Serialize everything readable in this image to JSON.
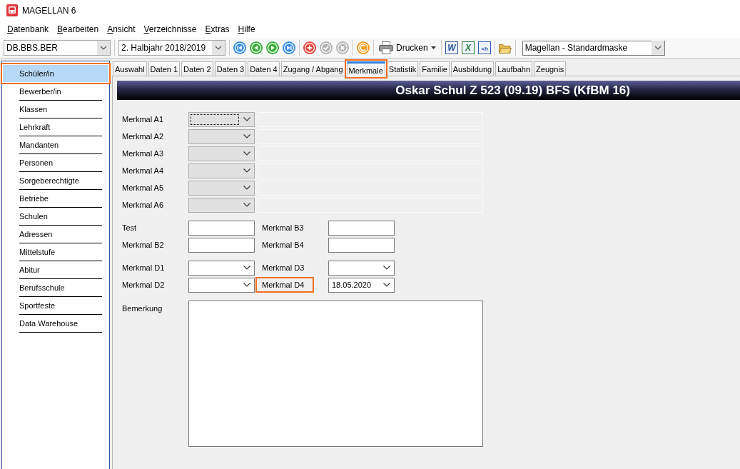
{
  "window": {
    "title": "MAGELLAN 6"
  },
  "menu": [
    {
      "label": "Datenbank"
    },
    {
      "label": "Bearbeiten"
    },
    {
      "label": "Ansicht"
    },
    {
      "label": "Verzeichnisse"
    },
    {
      "label": "Extras"
    },
    {
      "label": "Hilfe"
    }
  ],
  "toolbar": {
    "groups": [
      [
        {
          "kind": "combo",
          "value": "DB.BBS.BER"
        }
      ],
      [
        {
          "kind": "combo",
          "value": "2. Halbjahr 2018/2019"
        }
      ],
      [
        {
          "kind": "first",
          "disabled": false
        },
        {
          "kind": "previous",
          "disabled": false
        },
        {
          "kind": "next",
          "disabled": false
        },
        {
          "kind": "last",
          "disabled": false
        }
      ],
      [
        {
          "kind": "add",
          "disabled": false
        },
        {
          "kind": "save",
          "disabled": true
        },
        {
          "kind": "cancel",
          "disabled": true
        }
      ],
      [
        {
          "kind": "refresh",
          "disabled": false
        }
      ],
      [
        {
          "kind": "print",
          "label": "Drucken",
          "disabled": false
        }
      ],
      [
        {
          "kind": "word",
          "glyph": "W",
          "disabled": false
        },
        {
          "kind": "excel",
          "glyph": "X",
          "disabled": false
        },
        {
          "kind": "html",
          "glyph": "<h",
          "disabled": false
        }
      ],
      [
        {
          "kind": "folder",
          "disabled": false
        }
      ],
      [
        {
          "kind": "combo",
          "value": "Magellan - Standardmaske"
        }
      ]
    ]
  },
  "sidebar": {
    "items": [
      {
        "label": "Schüler/in",
        "selected": true,
        "highlighted": true
      },
      {
        "label": "Bewerber/in",
        "selected": false,
        "highlighted": false
      },
      {
        "label": "Klassen",
        "selected": false,
        "highlighted": false
      },
      {
        "label": "Lehrkraft",
        "selected": false,
        "highlighted": false
      },
      {
        "label": "Mandanten",
        "selected": false,
        "highlighted": false
      },
      {
        "label": "Personen",
        "selected": false,
        "highlighted": false
      },
      {
        "label": "Sorgeberechtigte",
        "selected": false,
        "highlighted": false
      },
      {
        "label": "Betriebe",
        "selected": false,
        "highlighted": false
      },
      {
        "label": "Schulen",
        "selected": false,
        "highlighted": false
      },
      {
        "label": "Adressen",
        "selected": false,
        "highlighted": false
      },
      {
        "label": "Mittelstufe",
        "selected": false,
        "highlighted": false
      },
      {
        "label": "Abitur",
        "selected": false,
        "highlighted": false
      },
      {
        "label": "Berufsschule",
        "selected": false,
        "highlighted": false
      },
      {
        "label": "Sportfeste",
        "selected": false,
        "highlighted": false
      },
      {
        "label": "Data Warehouse",
        "selected": false,
        "highlighted": false
      }
    ]
  },
  "tabs": [
    {
      "label": "Auswahl",
      "selected": false,
      "highlighted": false
    },
    {
      "label": "Daten 1",
      "selected": false,
      "highlighted": false
    },
    {
      "label": "Daten 2",
      "selected": false,
      "highlighted": false
    },
    {
      "label": "Daten 3",
      "selected": false,
      "highlighted": false
    },
    {
      "label": "Daten 4",
      "selected": false,
      "highlighted": false
    },
    {
      "label": "Zugang / Abgang",
      "selected": false,
      "highlighted": false
    },
    {
      "label": "Merkmale",
      "selected": true,
      "highlighted": true
    },
    {
      "label": "Statistik",
      "selected": false,
      "highlighted": false
    },
    {
      "label": "Familie",
      "selected": false,
      "highlighted": false
    },
    {
      "label": "Ausbildung",
      "selected": false,
      "highlighted": false
    },
    {
      "label": "Laufbahn",
      "selected": false,
      "highlighted": false
    },
    {
      "label": "Zeugnis",
      "selected": false,
      "highlighted": false
    }
  ],
  "record_title": "Oskar Schul Z 523 (09.19) BFS (KfBM 16)",
  "form": {
    "merkmal_a": [
      {
        "label": "Merkmal A1",
        "select": {
          "disabled": true,
          "focused": true
        },
        "description": {
          "disabled": true
        }
      },
      {
        "label": "Merkmal A2",
        "select": {
          "disabled": true,
          "focused": false
        },
        "description": {
          "disabled": true
        }
      },
      {
        "label": "Merkmal A3",
        "select": {
          "disabled": true,
          "focused": false
        },
        "description": {
          "disabled": true
        }
      },
      {
        "label": "Merkmal A4",
        "select": {
          "disabled": true,
          "focused": false
        },
        "description": {
          "disabled": true
        }
      },
      {
        "label": "Merkmal A5",
        "select": {
          "disabled": true,
          "focused": false
        },
        "description": {
          "disabled": true
        }
      },
      {
        "label": "Merkmal A6",
        "select": {
          "disabled": true,
          "focused": false
        },
        "description": {
          "disabled": true
        }
      }
    ],
    "field_groups": [
      [
        [
          {
            "label": "Test",
            "kind": "text",
            "highlighted": false
          },
          {
            "label": "Merkmal B3",
            "kind": "text",
            "highlighted": false
          }
        ],
        [
          {
            "label": "Merkmal B2",
            "kind": "text",
            "highlighted": false
          },
          {
            "label": "Merkmal B4",
            "kind": "text",
            "highlighted": false
          }
        ]
      ],
      [
        [
          {
            "label": "Merkmal D1",
            "kind": "select",
            "highlighted": false
          },
          {
            "label": "Merkmal D3",
            "kind": "select",
            "highlighted": false
          }
        ],
        [
          {
            "label": "Merkmal D2",
            "kind": "select",
            "highlighted": false
          },
          {
            "label": "Merkmal D4",
            "kind": "select",
            "value": "18.05.2020",
            "highlighted": true
          }
        ]
      ]
    ],
    "remark": {
      "label": "Bemerkung"
    }
  }
}
